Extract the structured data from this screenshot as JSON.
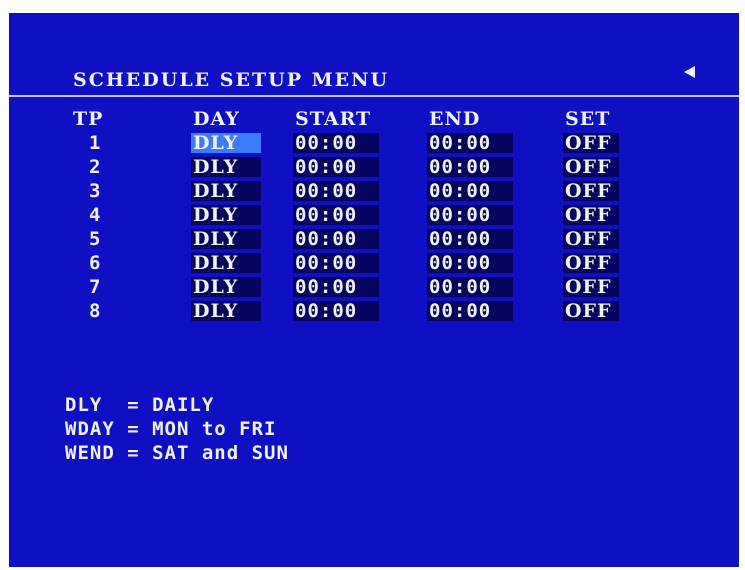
{
  "menu": {
    "title": "SCHEDULE SETUP MENU",
    "back_icon": "left-arrow-icon"
  },
  "table": {
    "headers": {
      "tp": "TP",
      "day": "DAY",
      "start": "START",
      "end": "END",
      "set": "SET"
    },
    "rows": [
      {
        "tp": "1",
        "day": "DLY",
        "start": "00:00",
        "end": "00:00",
        "set": "OFF"
      },
      {
        "tp": "2",
        "day": "DLY",
        "start": "00:00",
        "end": "00:00",
        "set": "OFF"
      },
      {
        "tp": "3",
        "day": "DLY",
        "start": "00:00",
        "end": "00:00",
        "set": "OFF"
      },
      {
        "tp": "4",
        "day": "DLY",
        "start": "00:00",
        "end": "00:00",
        "set": "OFF"
      },
      {
        "tp": "5",
        "day": "DLY",
        "start": "00:00",
        "end": "00:00",
        "set": "OFF"
      },
      {
        "tp": "6",
        "day": "DLY",
        "start": "00:00",
        "end": "00:00",
        "set": "OFF"
      },
      {
        "tp": "7",
        "day": "DLY",
        "start": "00:00",
        "end": "00:00",
        "set": "OFF"
      },
      {
        "tp": "8",
        "day": "DLY",
        "start": "00:00",
        "end": "00:00",
        "set": "OFF"
      }
    ]
  },
  "legend": [
    "DLY  = DAILY",
    "WDAY = MON to FRI",
    "WEND = SAT and SUN"
  ],
  "colors": {
    "background": "#0f0fc3",
    "text": "#f2f2f2",
    "field_bg": "#050560",
    "cursor_highlight": "#3b7bff"
  }
}
